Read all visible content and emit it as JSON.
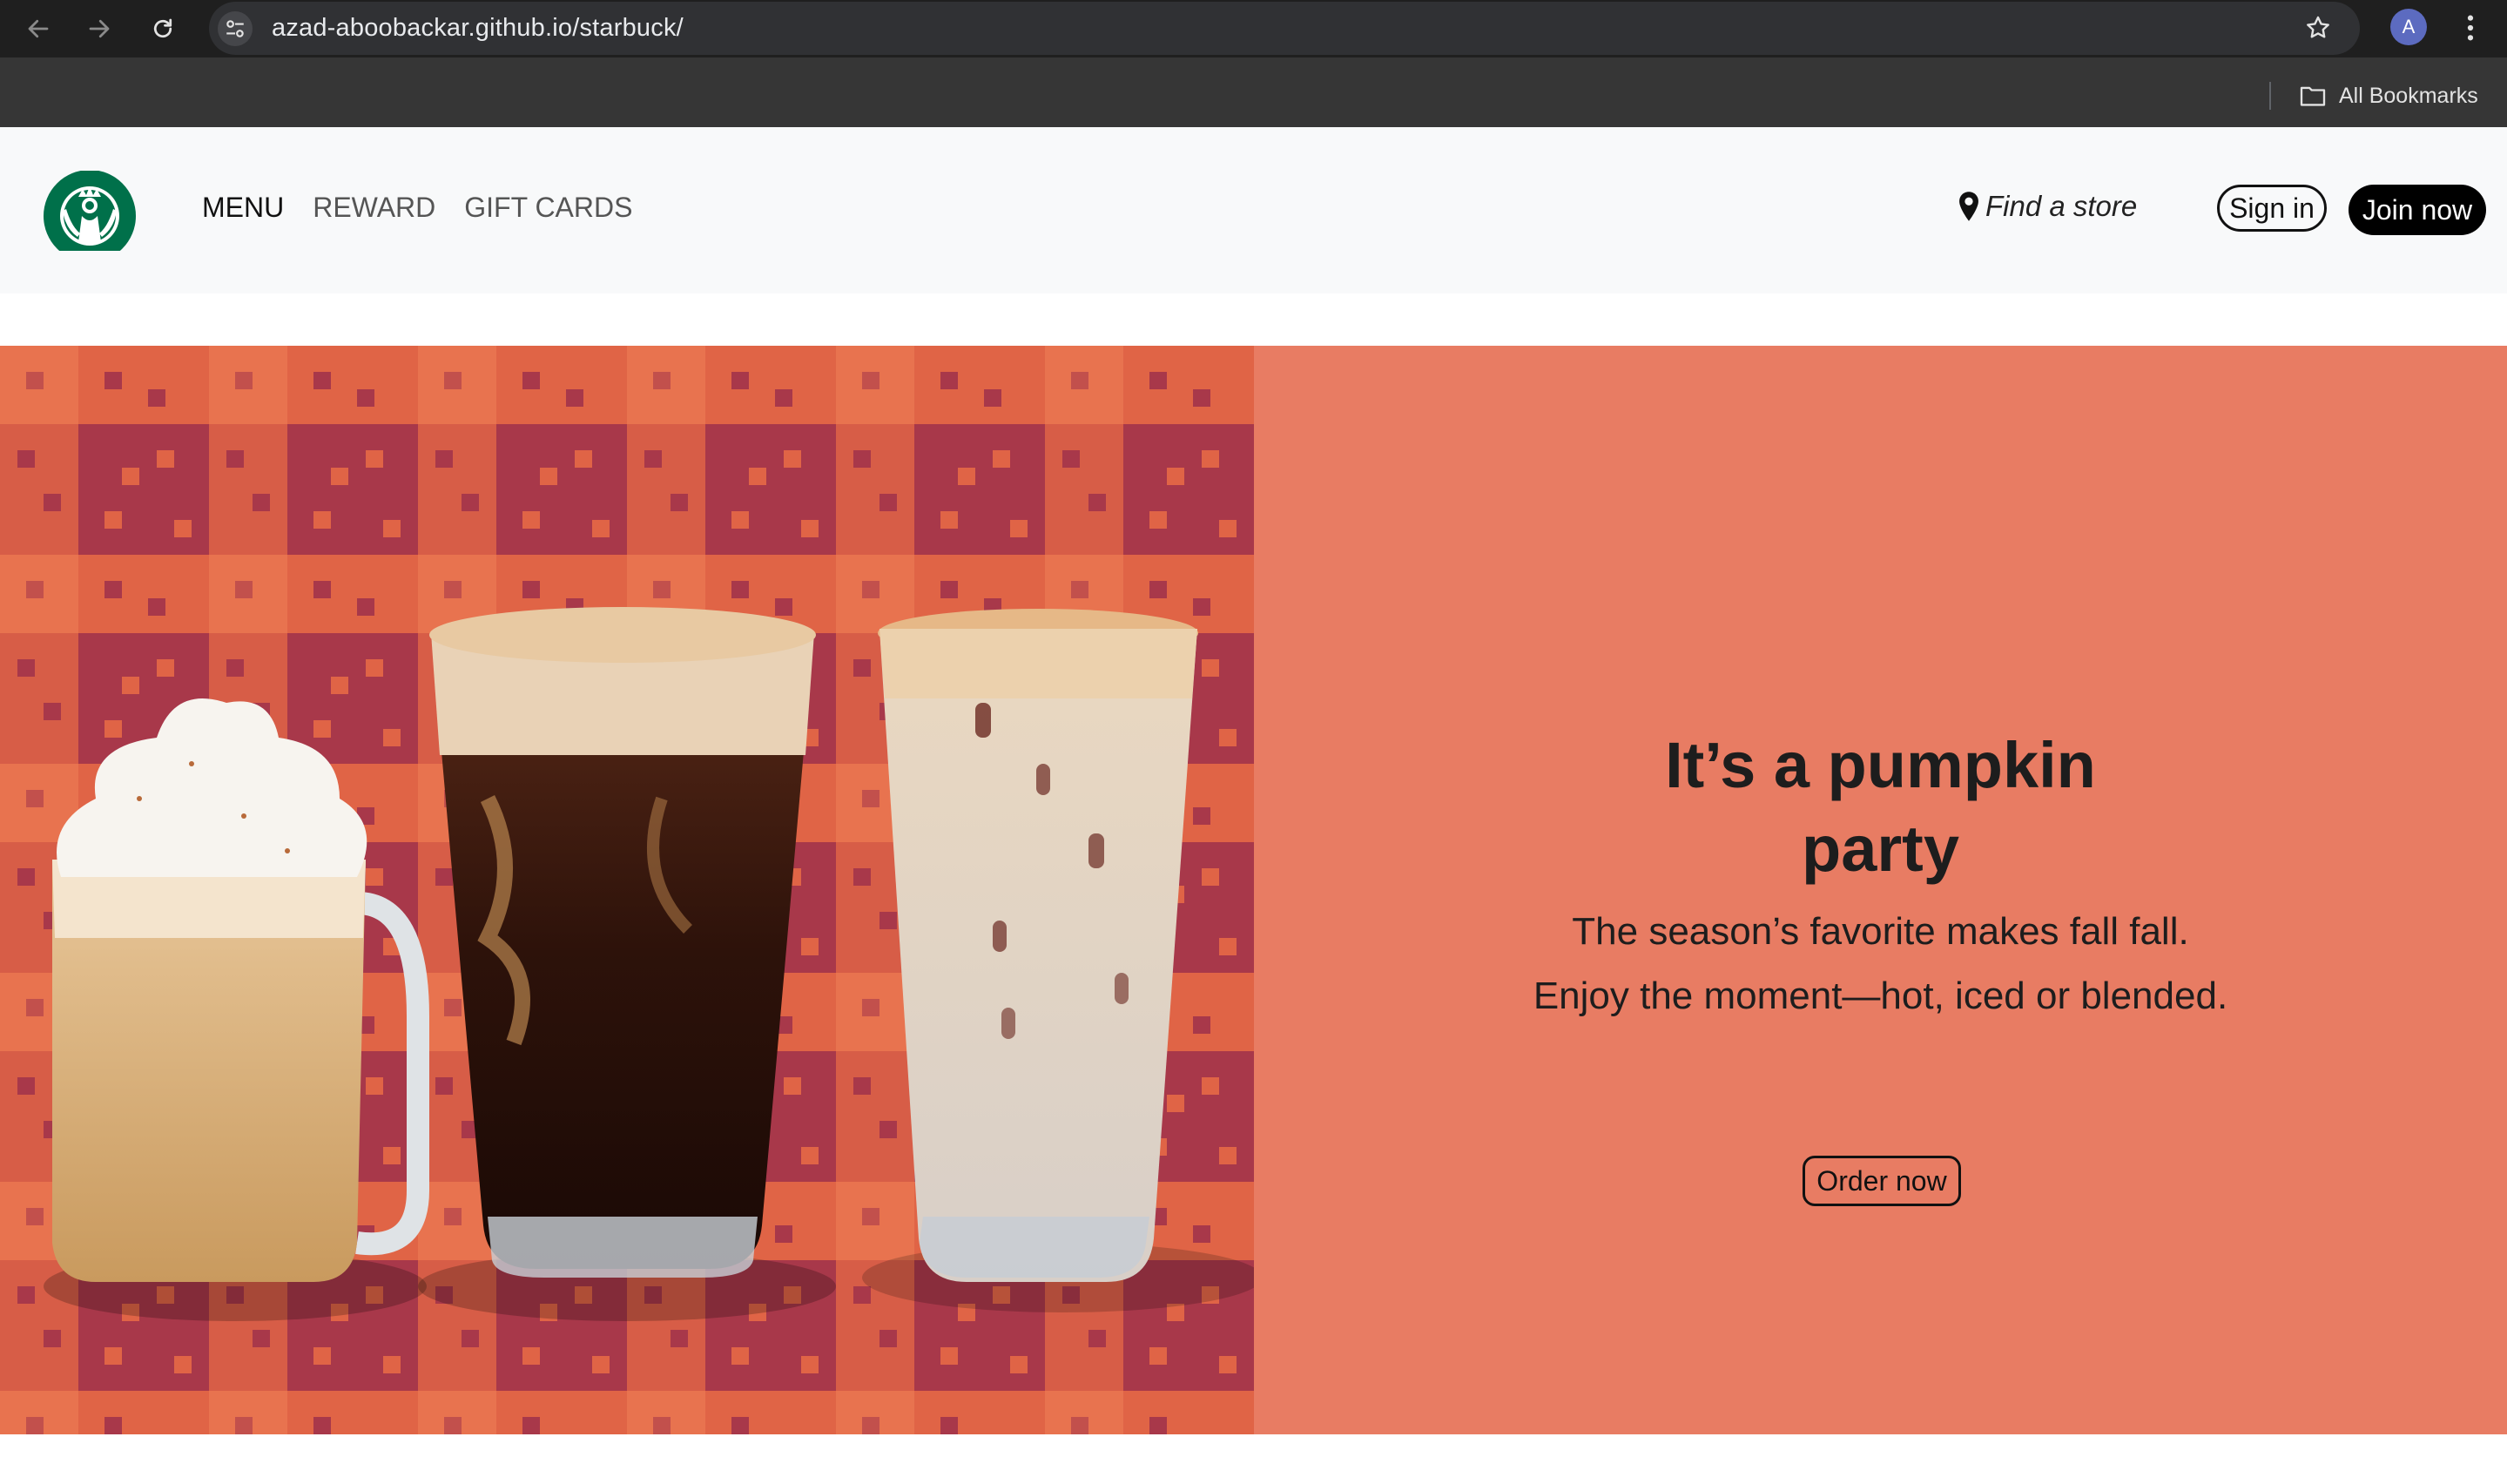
{
  "browser": {
    "url": "azad-aboobackar.github.io/starbuck/",
    "profile_initial": "A",
    "bookmarks_label": "All Bookmarks"
  },
  "header": {
    "nav": [
      {
        "label": "MENU"
      },
      {
        "label": "REWARD"
      },
      {
        "label": "GIFT CARDS"
      }
    ],
    "find_store": "Find a store",
    "sign_in": "Sign in",
    "join_now": "Join now"
  },
  "hero": {
    "title": "It’s a pumpkin party",
    "subtitle_line1": "The season’s favorite makes fall fall.",
    "subtitle_line2": "Enjoy the moment—hot, iced or blended.",
    "cta": "Order now"
  },
  "colors": {
    "hero_panel": "#e87c63",
    "plaid_dark": "#a8384a",
    "plaid_light": "#e06446",
    "header_bg": "#f8f9fa",
    "brand_green": "#00704a"
  },
  "icons": {
    "back": "arrow-left-icon",
    "forward": "arrow-right-icon",
    "reload": "reload-icon",
    "site_info": "tune-icon",
    "bookmark": "star-outline-icon",
    "menu": "vertical-dots-icon",
    "folder": "folder-icon",
    "location": "map-pin-icon",
    "logo": "siren-logo"
  }
}
